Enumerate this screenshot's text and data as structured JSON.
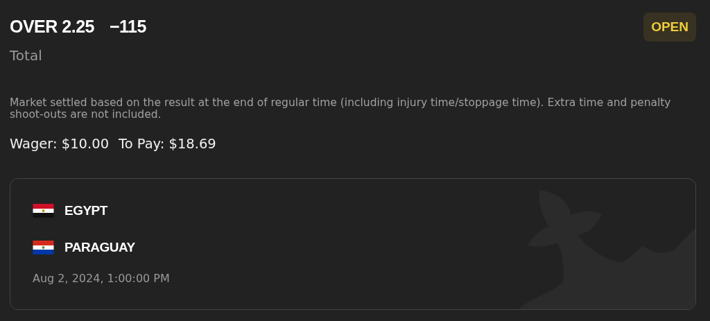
{
  "bet": {
    "selection": "OVER 2.25",
    "odds": "−115",
    "status": {
      "label": "OPEN",
      "kind": "open"
    },
    "market": "Total",
    "rules": "Market settled based on the result at the end of regular time (including injury time/stoppage time). Extra time and penalty shoot-outs are not included.",
    "wager": "Wager: $10.00",
    "to_pay": "To Pay: $18.69"
  },
  "event": {
    "teams": [
      {
        "name": "EGYPT",
        "kind": "egypt"
      },
      {
        "name": "PARAGUAY",
        "kind": "paraguay"
      }
    ],
    "start_time": "Aug 2, 2024, 1:00:00 PM"
  }
}
